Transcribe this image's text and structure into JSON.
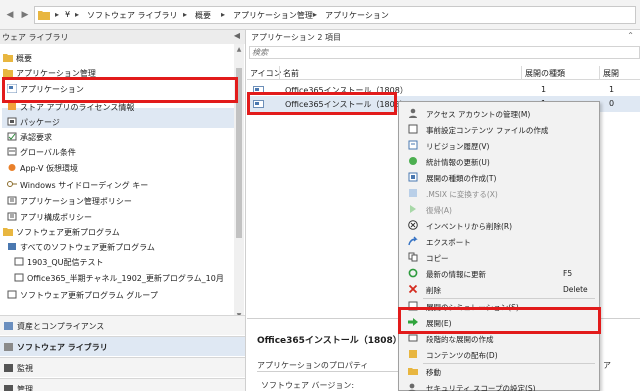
{
  "breadcrumb": [
    "¥",
    "ソフトウェア ライブラリ",
    "概要",
    "アプリケーション管理",
    "アプリケーション"
  ],
  "left_pane": {
    "header": "ウェア ライブラリ",
    "items": [
      {
        "label": "概要",
        "icon": "folder-icon"
      },
      {
        "label": "アプリケーション管理",
        "icon": "folder-icon"
      },
      {
        "label": "アプリケーション",
        "icon": "application-icon"
      },
      {
        "label": "ストア アプリのライセンス情報",
        "icon": "store-license-icon"
      },
      {
        "label": "パッケージ",
        "icon": "package-icon"
      },
      {
        "label": "承認要求",
        "icon": "approval-icon"
      },
      {
        "label": "グローバル条件",
        "icon": "condition-icon"
      },
      {
        "label": "App-V 仮想環境",
        "icon": "appv-icon"
      },
      {
        "label": "Windows サイドローディング キー",
        "icon": "key-icon"
      },
      {
        "label": "アプリケーション管理ポリシー",
        "icon": "policy-icon"
      },
      {
        "label": "アプリ構成ポリシー",
        "icon": "policy-icon"
      },
      {
        "label": "ソフトウェア更新プログラム",
        "icon": "folder-icon"
      },
      {
        "label": "すべてのソフトウェア更新プログラム",
        "icon": "update-icon"
      },
      {
        "label": "1903_QU配信テスト",
        "icon": "update-group-icon"
      },
      {
        "label": "Office365_半期チャネル_1902_更新プログラム_10月",
        "icon": "update-group-icon"
      },
      {
        "label": "ソフトウェア更新プログラム グループ",
        "icon": "update-group-icon"
      }
    ]
  },
  "workspaces": [
    {
      "label": "資産とコンプライアンス"
    },
    {
      "label": "ソフトウェア ライブラリ"
    },
    {
      "label": "監視"
    },
    {
      "label": "管理"
    }
  ],
  "list": {
    "title": "アプリケーション 2 項目",
    "search_placeholder": "検索",
    "columns": [
      "アイコン",
      "名前",
      "展開の種類",
      "展開"
    ],
    "rows": [
      {
        "name": "Office365インストール（1808）",
        "deploy_types": "1",
        "deployments": "1"
      },
      {
        "name": "Office365インストール（1808）",
        "deploy_types": "1",
        "deployments": "0"
      }
    ]
  },
  "details": {
    "title": "Office365インストール（1808）",
    "section": "アプリケーションのプロパティ",
    "section_right": "ア",
    "property": "ソフトウェア バージョン:"
  },
  "context_menu": [
    {
      "label": "アクセス アカウントの管理(M)",
      "icon": "account-icon"
    },
    {
      "label": "事前設定コンテンツ ファイルの作成",
      "icon": "content-file-icon"
    },
    {
      "label": "リビジョン履歴(V)",
      "icon": "revision-icon"
    },
    {
      "label": "統計情報の更新(U)",
      "icon": "statistics-icon"
    },
    {
      "label": "展開の種類の作成(T)",
      "icon": "deploy-type-icon"
    },
    {
      "label": ".MSIX に変換する(X)",
      "icon": "msix-icon"
    },
    {
      "label": "復帰(A)",
      "icon": "revert-icon"
    },
    {
      "label": "インベントリから削除(R)",
      "icon": "remove-icon"
    },
    {
      "label": "エクスポート",
      "icon": "export-icon"
    },
    {
      "label": "コピー",
      "icon": "copy-icon"
    },
    {
      "label": "最新の情報に更新",
      "shortcut": "F5",
      "icon": "refresh-icon"
    },
    {
      "label": "削除",
      "shortcut": "Delete",
      "icon": "delete-icon"
    },
    {
      "label": "展開のシミュレーション(S)",
      "icon": "simulate-icon"
    },
    {
      "label": "展開(E)",
      "icon": "deploy-icon"
    },
    {
      "label": "段階的な展開の作成",
      "icon": "phased-icon"
    },
    {
      "label": "コンテンツの配布(D)",
      "icon": "distribute-icon"
    },
    {
      "label": "移動",
      "icon": "move-icon"
    },
    {
      "label": "セキュリティ スコープの設定(S)",
      "icon": "scope-icon"
    }
  ],
  "colors": {
    "highlight": "#e21b1b",
    "selection": "#dfe8f3",
    "menu_bg": "#f2f2f2"
  }
}
